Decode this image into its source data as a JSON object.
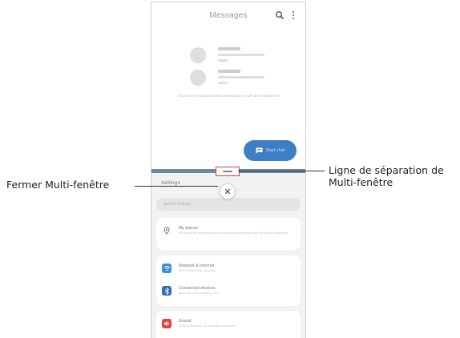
{
  "messages": {
    "title": "Messages",
    "empty_text": "Once you've started a new conversation, you'll see it listed here",
    "fab_label": "Start chat",
    "icons": [
      "search-icon",
      "more-vert-icon",
      "chat-icon"
    ]
  },
  "settings": {
    "title": "Settings",
    "search_placeholder": "Search settings",
    "items": [
      {
        "title": "My places",
        "subtitle": "Set places as home and work for location-based features such as Context Awareness",
        "icon": "location-pin-icon",
        "color": "#ffffff"
      },
      {
        "title": "Network & internet",
        "subtitle": "Wi-Fi, Mobile data, Tethering",
        "icon": "wifi-icon",
        "color": "#3b8fd6"
      },
      {
        "title": "Connected devices",
        "subtitle": "Bluetooth, Screen sharing, NFC",
        "icon": "bluetooth-icon",
        "color": "#2f6fb8"
      },
      {
        "title": "Sound",
        "subtitle": "Volume, Ringtone, Sound quality and effects",
        "icon": "volume-icon",
        "color": "#e0463c"
      }
    ]
  },
  "callouts": {
    "close": "Fermer Multi-fenêtre",
    "divider_line1": "Ligne de séparation de",
    "divider_line2": "Multi-fenêtre"
  },
  "colors": {
    "accent": "#3d7fc4",
    "divider": "#6c8aa0",
    "highlight": "#d04040"
  }
}
